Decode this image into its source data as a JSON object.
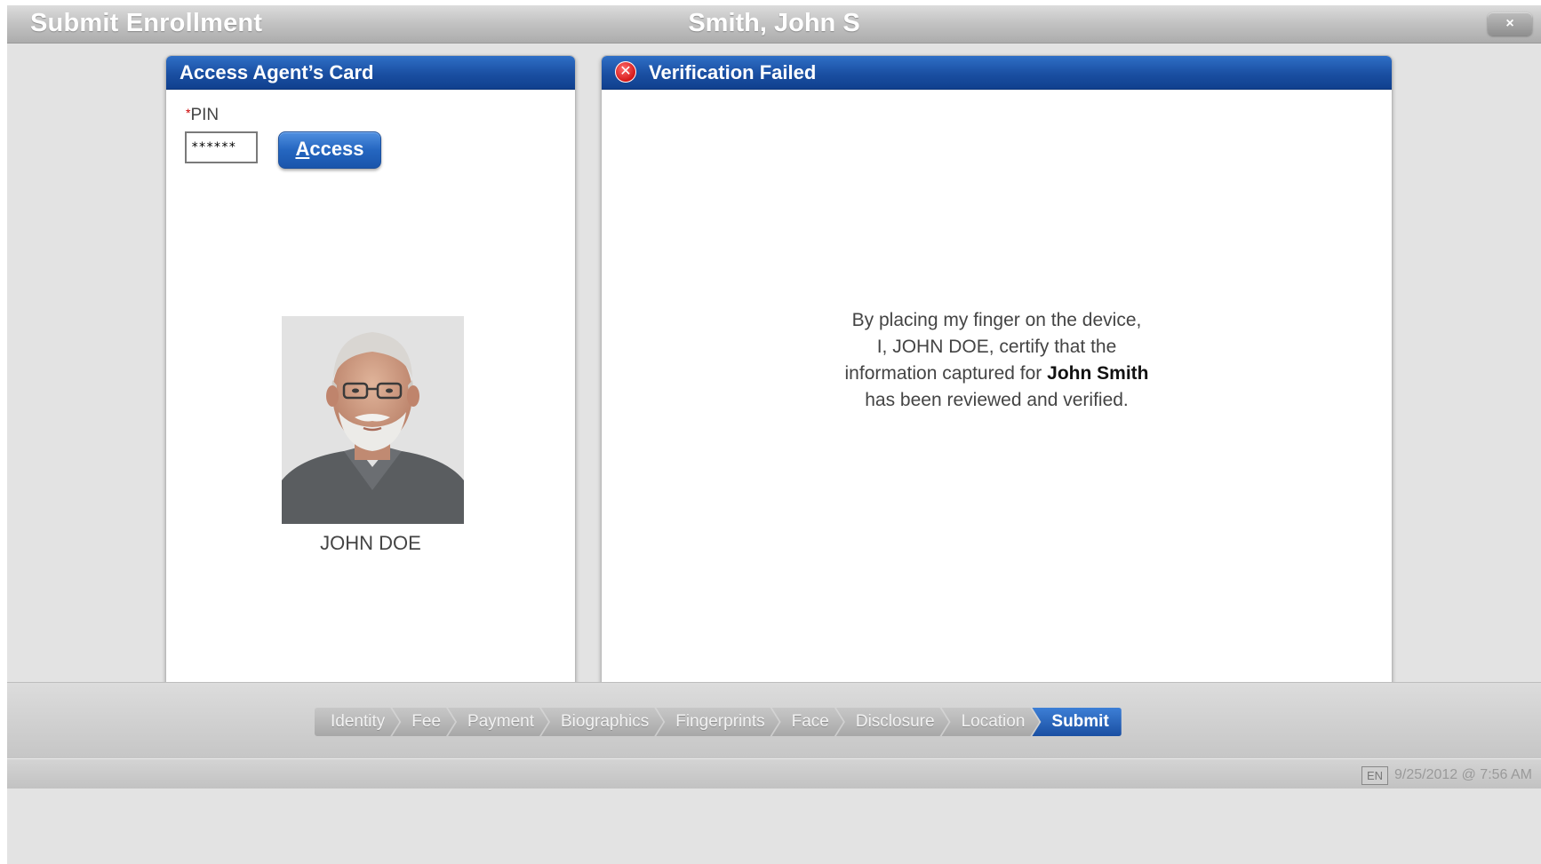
{
  "header": {
    "title": "Submit Enrollment",
    "client_name": "Smith, John S",
    "close_label": "×"
  },
  "agent_panel": {
    "title": "Access Agent’s Card",
    "pin_required_marker": "*",
    "pin_label": "PIN",
    "pin_value": "******",
    "access_button_first": "A",
    "access_button_rest": "ccess",
    "agent_name": "JOHN DOE"
  },
  "verification_panel": {
    "title": "Verification Failed",
    "error_icon": "✕",
    "line1": "By placing my finger on the device,",
    "line2": "I, JOHN DOE, certify that the",
    "line3_prefix": "information captured for ",
    "line3_bold": "John Smith",
    "line4": "has been reviewed and verified."
  },
  "workflow": {
    "steps": [
      "Identity",
      "Fee",
      "Payment",
      "Biographics",
      "Fingerprints",
      "Face",
      "Disclosure",
      "Location",
      "Submit"
    ],
    "active_step": "Submit"
  },
  "status": {
    "language": "EN",
    "datetime": "9/25/2012 @ 7:56 AM"
  }
}
